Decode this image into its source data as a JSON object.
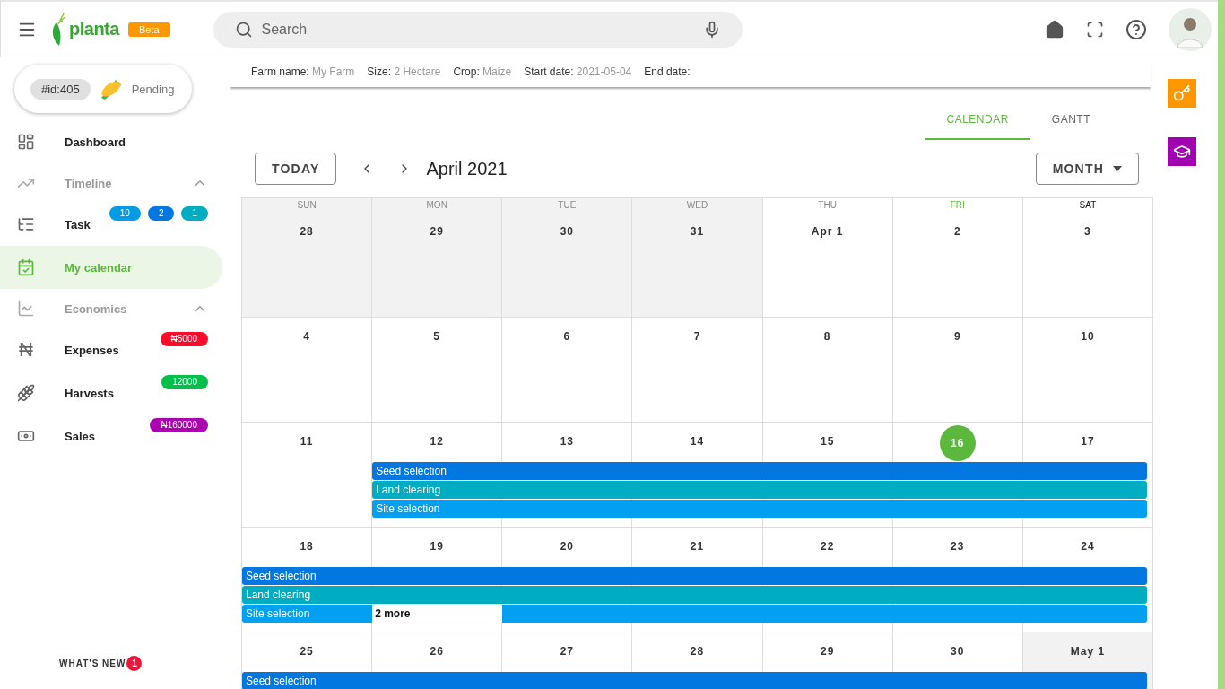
{
  "header": {
    "brand": "planta",
    "badge": "Beta",
    "search": {
      "placeholder": "Search"
    }
  },
  "farm_pill": {
    "id": "#id:405",
    "status": "Pending"
  },
  "sidebar": {
    "items": [
      {
        "kind": "item",
        "label": "Dashboard",
        "selected": false
      },
      {
        "kind": "section",
        "label": "Timeline",
        "expanded": true
      },
      {
        "kind": "item",
        "label": "Task",
        "selected": false,
        "badges": [
          {
            "text": "10",
            "color": "#039be5"
          },
          {
            "text": "2",
            "color": "#0277e0"
          },
          {
            "text": "1",
            "color": "#00acc1"
          }
        ]
      },
      {
        "kind": "item",
        "label": "My calendar",
        "selected": true
      },
      {
        "kind": "section",
        "label": "Economics",
        "expanded": true
      },
      {
        "kind": "item",
        "label": "Expenses",
        "glyph": "₦",
        "selected": false,
        "badges": [
          {
            "text": "₦5000",
            "color": "#ff0a2b"
          }
        ]
      },
      {
        "kind": "item",
        "label": "Harvests",
        "selected": false,
        "badges": [
          {
            "text": "12000",
            "color": "#00c04b"
          }
        ]
      },
      {
        "kind": "item",
        "label": "Sales",
        "selected": false,
        "badges": [
          {
            "text": "₦160000",
            "color": "#aa00b0"
          }
        ]
      }
    ]
  },
  "whats_new": {
    "label": "WHAT'S NEW",
    "count": "1"
  },
  "farm_info": [
    {
      "label": "Farm name:",
      "value": "My Farm"
    },
    {
      "label": "Size:",
      "value": "2 Hectare"
    },
    {
      "label": "Crop:",
      "value": "Maize"
    },
    {
      "label": "Start date:",
      "value": "2021-05-04"
    },
    {
      "label": "End date:"
    }
  ],
  "view_tabs": [
    {
      "label": "CALENDAR",
      "selected": true
    },
    {
      "label": "GANTT",
      "selected": false
    }
  ],
  "toolbar": {
    "today_button": "TODAY",
    "title": "April 2021",
    "view_select": "MONTH"
  },
  "calendar": {
    "weekdays": [
      {
        "label": "SUN",
        "today": false,
        "hovered": false
      },
      {
        "label": "MON",
        "today": false,
        "hovered": false
      },
      {
        "label": "TUE",
        "today": false,
        "hovered": false
      },
      {
        "label": "WED",
        "today": false,
        "hovered": false
      },
      {
        "label": "THU",
        "today": false,
        "hovered": false
      },
      {
        "label": "FRI",
        "today": true,
        "hovered": false
      },
      {
        "label": "SAT",
        "today": false,
        "hovered": true
      }
    ],
    "weeks": [
      {
        "days": [
          {
            "label": "28",
            "outside": true,
            "today": false
          },
          {
            "label": "29",
            "outside": true,
            "today": false
          },
          {
            "label": "30",
            "outside": true,
            "today": false
          },
          {
            "label": "31",
            "outside": true,
            "today": false
          },
          {
            "label": "Apr 1",
            "outside": false,
            "today": false
          },
          {
            "label": "2",
            "outside": false,
            "today": false
          },
          {
            "label": "3",
            "outside": false,
            "today": false
          }
        ]
      },
      {
        "days": [
          {
            "label": "4",
            "outside": false,
            "today": false
          },
          {
            "label": "5",
            "outside": false,
            "today": false
          },
          {
            "label": "6",
            "outside": false,
            "today": false
          },
          {
            "label": "7",
            "outside": false,
            "today": false
          },
          {
            "label": "8",
            "outside": false,
            "today": false
          },
          {
            "label": "9",
            "outside": false,
            "today": false
          },
          {
            "label": "10",
            "outside": false,
            "today": false
          }
        ]
      },
      {
        "days": [
          {
            "label": "11",
            "outside": false,
            "today": false
          },
          {
            "label": "12",
            "outside": false,
            "today": false
          },
          {
            "label": "13",
            "outside": false,
            "today": false
          },
          {
            "label": "14",
            "outside": false,
            "today": false
          },
          {
            "label": "15",
            "outside": false,
            "today": false
          },
          {
            "label": "16",
            "outside": false,
            "today": true
          },
          {
            "label": "17",
            "outside": false,
            "today": false
          }
        ],
        "events": [
          {
            "label": "Seed selection",
            "color": "#0277e0"
          },
          {
            "label": "Land clearing",
            "color": "#00acc1"
          },
          {
            "label": "Site selection",
            "color": "#039ff0"
          }
        ]
      },
      {
        "days": [
          {
            "label": "18",
            "outside": false,
            "today": false
          },
          {
            "label": "19",
            "outside": false,
            "today": false
          },
          {
            "label": "20",
            "outside": false,
            "today": false
          },
          {
            "label": "21",
            "outside": false,
            "today": false
          },
          {
            "label": "22",
            "outside": false,
            "today": false
          },
          {
            "label": "23",
            "outside": false,
            "today": false
          },
          {
            "label": "24",
            "outside": false,
            "today": false
          }
        ],
        "events": [
          {
            "label": "Seed selection",
            "color": "#0277e0"
          },
          {
            "label": "Land clearing",
            "color": "#00acc1"
          },
          {
            "label": "Site selection",
            "color": "#039ff0"
          }
        ],
        "more": {
          "label": "2 more"
        }
      },
      {
        "days": [
          {
            "label": "25",
            "outside": false,
            "today": false
          },
          {
            "label": "26",
            "outside": false,
            "today": false
          },
          {
            "label": "27",
            "outside": false,
            "today": false
          },
          {
            "label": "28",
            "outside": false,
            "today": false
          },
          {
            "label": "29",
            "outside": false,
            "today": false
          },
          {
            "label": "30",
            "outside": false,
            "today": false
          },
          {
            "label": "May 1",
            "outside": true,
            "today": false
          }
        ],
        "events": [
          {
            "label": "Seed selection",
            "color": "#0277e0"
          }
        ]
      }
    ]
  }
}
